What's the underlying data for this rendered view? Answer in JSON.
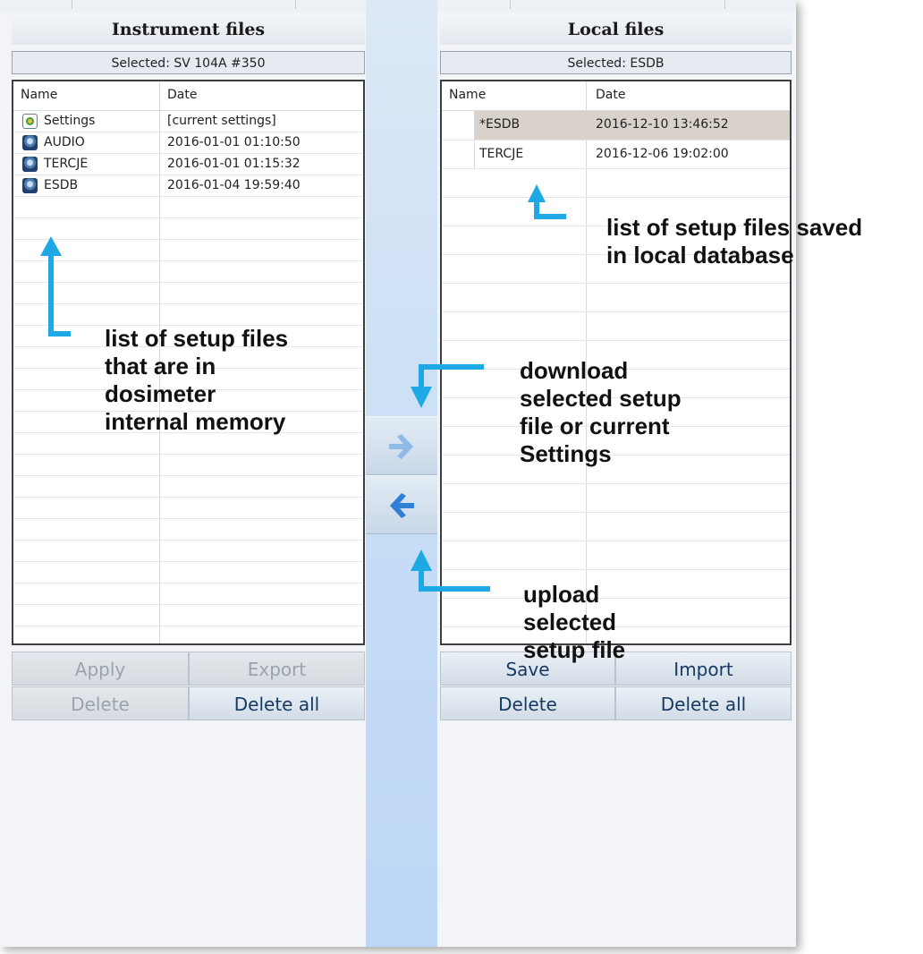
{
  "left_panel": {
    "title": "Instrument files",
    "selected": "Selected: SV 104A #350",
    "col_name": "Name",
    "col_date": "Date",
    "rows": [
      {
        "name": "Settings",
        "date": "[current settings]",
        "icon": "settings-icon"
      },
      {
        "name": "AUDIO",
        "date": "2016-01-01 01:10:50",
        "icon": "instrument-file-icon"
      },
      {
        "name": "TERCJE",
        "date": "2016-01-01 01:15:32",
        "icon": "instrument-file-icon"
      },
      {
        "name": "ESDB",
        "date": "2016-01-04 19:59:40",
        "icon": "instrument-file-icon"
      }
    ],
    "buttons": {
      "apply": "Apply",
      "export": "Export",
      "delete": "Delete",
      "delete_all": "Delete all"
    }
  },
  "right_panel": {
    "title": "Local files",
    "selected": "Selected: ESDB",
    "col_name": "Name",
    "col_date": "Date",
    "rows": [
      {
        "name": "*ESDB",
        "date": "2016-12-10 13:46:52",
        "selected": true
      },
      {
        "name": "TERCJE",
        "date": "2016-12-06 19:02:00",
        "selected": false
      }
    ],
    "buttons": {
      "save": "Save",
      "import": "Import",
      "delete": "Delete",
      "delete_all": "Delete all"
    }
  },
  "middle": {
    "download_icon": "arrow-right-icon",
    "upload_icon": "arrow-left-icon"
  },
  "annotations": {
    "instrument_list": "list of setup files\nthat are in\ndosimeter\ninternal  memory",
    "local_list": "list of setup files saved\nin local database",
    "download": "download\nselected setup\nfile or current\nSettings",
    "upload": "upload\nselected\nsetup file"
  },
  "colors": {
    "annotation_arrow": "#1fa8e6",
    "selected_row": "#d8d2ca",
    "button_text": "#163a63",
    "disabled_text": "#9aa3ac"
  }
}
